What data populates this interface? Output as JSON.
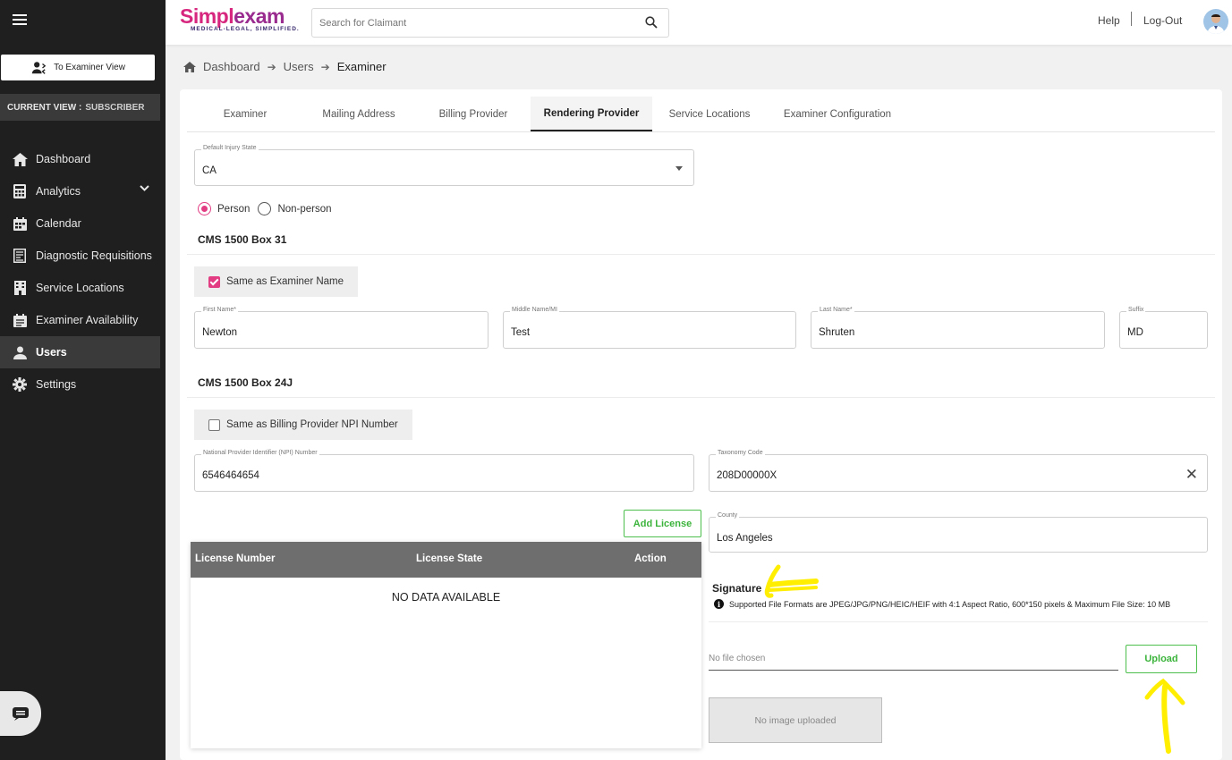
{
  "sidebar": {
    "examiner_view_label": "To Examiner View",
    "current_view_label": "CURRENT VIEW :",
    "current_view_value": "SUBSCRIBER",
    "items": [
      {
        "label": "Dashboard",
        "icon": "home-icon"
      },
      {
        "label": "Analytics",
        "icon": "calculator-icon"
      },
      {
        "label": "Calendar",
        "icon": "calendar-icon"
      },
      {
        "label": "Diagnostic Requisitions",
        "icon": "requisition-icon"
      },
      {
        "label": "Service Locations",
        "icon": "building-icon"
      },
      {
        "label": "Examiner Availability",
        "icon": "calendar-check-icon"
      },
      {
        "label": "Users",
        "icon": "user-icon"
      },
      {
        "label": "Settings",
        "icon": "gear-icon"
      }
    ]
  },
  "header": {
    "logo_simpl": "Simpl",
    "logo_exam": "exam",
    "logo_tagline": "MEDICAL-LEGAL, SIMPLIFIED.",
    "search_placeholder": "Search for Claimant",
    "help": "Help",
    "logout": "Log-Out"
  },
  "breadcrumb": [
    "Dashboard",
    "Users",
    "Examiner"
  ],
  "tabs": [
    "Examiner",
    "Mailing Address",
    "Billing Provider",
    "Rendering Provider",
    "Service Locations",
    "Examiner Configuration"
  ],
  "form": {
    "default_injury_state": {
      "label": "Default Injury State",
      "value": "CA"
    },
    "radio_person": "Person",
    "radio_nonperson": "Non-person",
    "box31_title": "CMS 1500 Box 31",
    "same_as_examiner": "Same as Examiner Name",
    "first_name": {
      "label": "First Name*",
      "value": "Newton"
    },
    "middle_name": {
      "label": "Middle Name/MI",
      "value": "Test"
    },
    "last_name": {
      "label": "Last Name*",
      "value": "Shruten"
    },
    "suffix": {
      "label": "Suffix",
      "value": "MD"
    },
    "box24j_title": "CMS 1500 Box 24J",
    "same_as_billing_npi": "Same as Billing Provider NPI Number",
    "npi": {
      "label": "National Provider Identifier (NPI) Number",
      "value": "6546464654"
    },
    "taxonomy": {
      "label": "Taxonomy Code",
      "value": "208D00000X"
    },
    "add_license": "Add License",
    "county": {
      "label": "County",
      "value": "Los Angeles"
    }
  },
  "license_table": {
    "columns": [
      "License Number",
      "License State",
      "Action"
    ],
    "empty_text": "NO DATA AVAILABLE"
  },
  "signature": {
    "title": "Signature",
    "info": "Supported File Formats are JPEG/JPG/PNG/HEIC/HEIF with 4:1 Aspect Ratio, 600*150 pixels & Maximum File Size: 10 MB",
    "file_placeholder": "No file chosen",
    "upload": "Upload",
    "no_image": "No image uploaded"
  },
  "colors": {
    "accent_pink": "#e23c82",
    "green": "#3cb43c",
    "sidebar_bg": "#1f1f1f",
    "annotation_yellow": "#ffee00"
  }
}
